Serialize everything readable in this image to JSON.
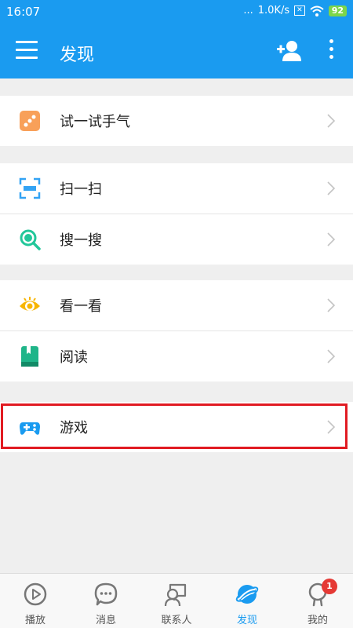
{
  "status_bar": {
    "time": "16:07",
    "dots": "...",
    "speed": "1.0K/s",
    "battery": "92"
  },
  "header": {
    "title": "发现"
  },
  "list": {
    "try_luck": "试一试手气",
    "scan": "扫一扫",
    "search": "搜一搜",
    "look": "看一看",
    "read": "阅读",
    "game": "游戏"
  },
  "nav": {
    "play": "播放",
    "messages": "消息",
    "contacts": "联系人",
    "discover": "发现",
    "me": "我的",
    "me_badge": "1"
  },
  "colors": {
    "primary": "#1a9bf0",
    "highlight": "#e11b22"
  }
}
